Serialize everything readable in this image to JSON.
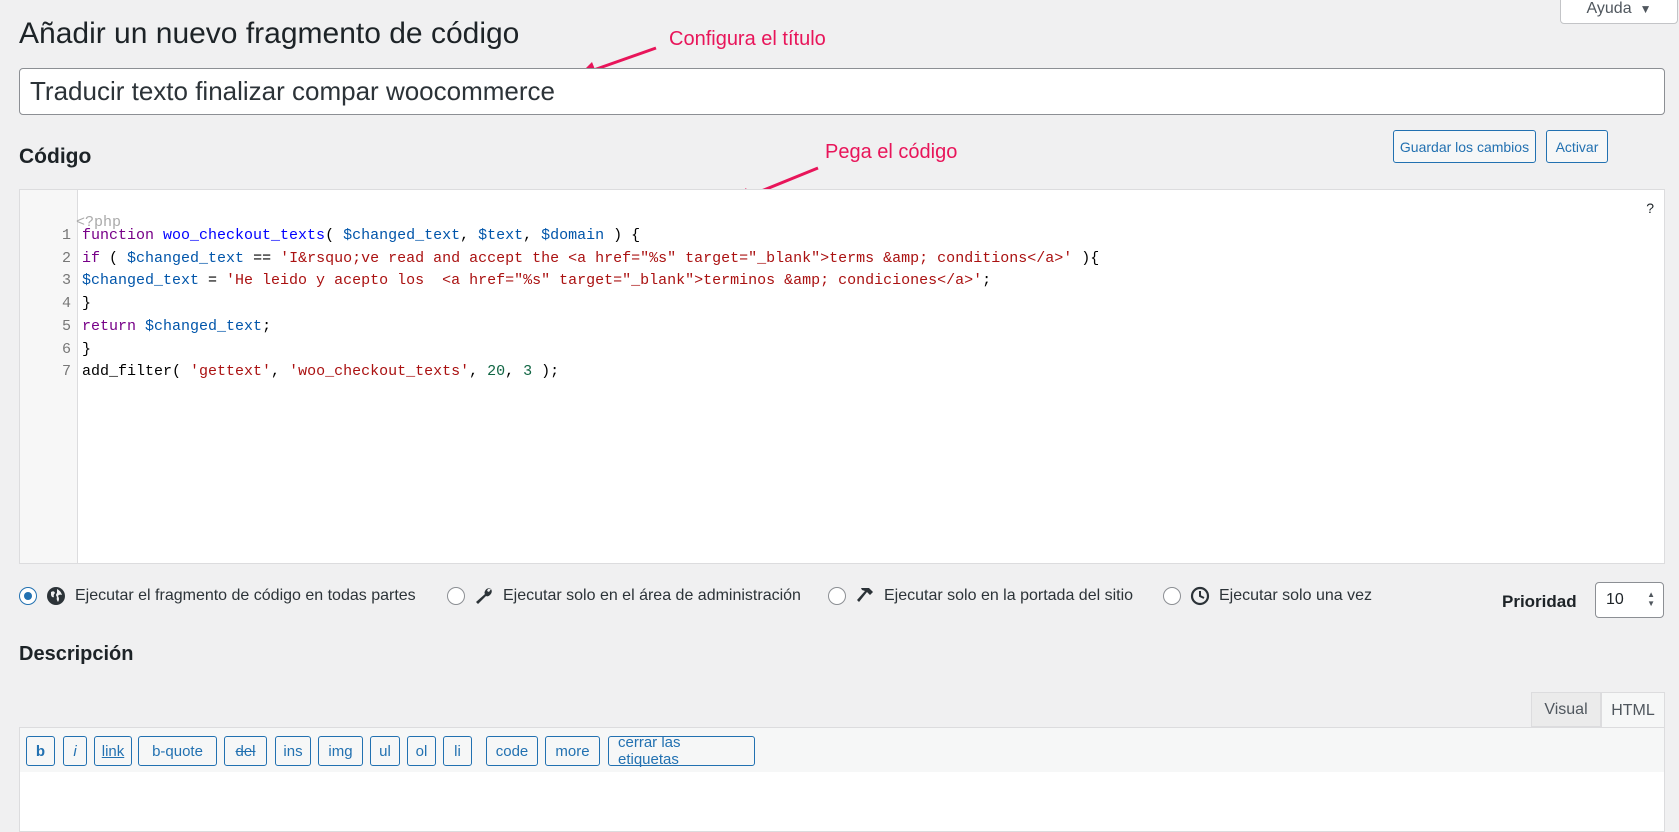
{
  "page": {
    "title": "Añadir un nuevo fragmento de código",
    "help_label": "Ayuda"
  },
  "snippet": {
    "title_value": "Traducir texto finalizar compar woocommerce"
  },
  "annotations": {
    "title_hint": "Configura el título",
    "code_hint": "Pega el código",
    "color": "#e8155a"
  },
  "code_section": {
    "heading": "Código",
    "save_label": "Guardar los cambios",
    "activate_label": "Activar",
    "php_open": "<?php",
    "help_mark": "?",
    "lines": [
      {
        "n": "1",
        "tokens": [
          {
            "t": "function",
            "c": "k"
          },
          {
            "t": " "
          },
          {
            "t": "woo_checkout_texts",
            "c": "f"
          },
          {
            "t": "( "
          },
          {
            "t": "$changed_text",
            "c": "v"
          },
          {
            "t": ", "
          },
          {
            "t": "$text",
            "c": "v"
          },
          {
            "t": ", "
          },
          {
            "t": "$domain",
            "c": "v"
          },
          {
            "t": " ) {"
          }
        ]
      },
      {
        "n": "2",
        "tokens": [
          {
            "t": "if",
            "c": "k"
          },
          {
            "t": " ( "
          },
          {
            "t": "$changed_text",
            "c": "v"
          },
          {
            "t": " == "
          },
          {
            "t": "'I&rsquo;ve read and accept the <a href=\"%s\" target=\"_blank\">terms &amp; conditions</a>'",
            "c": "s"
          },
          {
            "t": " ){"
          }
        ]
      },
      {
        "n": "3",
        "tokens": [
          {
            "t": "$changed_text",
            "c": "v"
          },
          {
            "t": " = "
          },
          {
            "t": "'He leido y acepto los  <a href=\"%s\" target=\"_blank\">terminos &amp; condiciones</a>'",
            "c": "s"
          },
          {
            "t": ";"
          }
        ]
      },
      {
        "n": "4",
        "tokens": [
          {
            "t": "}"
          }
        ]
      },
      {
        "n": "5",
        "tokens": [
          {
            "t": "return",
            "c": "k"
          },
          {
            "t": " "
          },
          {
            "t": "$changed_text",
            "c": "v"
          },
          {
            "t": ";"
          }
        ]
      },
      {
        "n": "6",
        "tokens": [
          {
            "t": "}"
          }
        ]
      },
      {
        "n": "7",
        "tokens": [
          {
            "t": "add_filter( "
          },
          {
            "t": "'gettext'",
            "c": "s"
          },
          {
            "t": ", "
          },
          {
            "t": "'woo_checkout_texts'",
            "c": "s"
          },
          {
            "t": ", "
          },
          {
            "t": "20",
            "c": "n"
          },
          {
            "t": ", "
          },
          {
            "t": "3",
            "c": "n"
          },
          {
            "t": " );"
          }
        ]
      }
    ]
  },
  "scope": {
    "options": [
      {
        "label": "Ejecutar el fragmento de código en todas partes",
        "icon": "globe-icon",
        "selected": true
      },
      {
        "label": "Ejecutar solo en el área de administración",
        "icon": "wrench-icon",
        "selected": false
      },
      {
        "label": "Ejecutar solo en la portada del sitio",
        "icon": "hammer-icon",
        "selected": false
      },
      {
        "label": "Ejecutar solo una vez",
        "icon": "clock-icon",
        "selected": false
      }
    ],
    "priority_label": "Prioridad",
    "priority_value": "10"
  },
  "description": {
    "heading": "Descripción",
    "tabs": {
      "visual": "Visual",
      "html": "HTML",
      "active": "HTML"
    },
    "quicktags": [
      "b",
      "i",
      "link",
      "b-quote",
      "del",
      "ins",
      "img",
      "ul",
      "ol",
      "li",
      "code",
      "more",
      "cerrar las etiquetas"
    ]
  },
  "colors": {
    "accent": "#2271b1",
    "background": "#f0f0f1"
  }
}
